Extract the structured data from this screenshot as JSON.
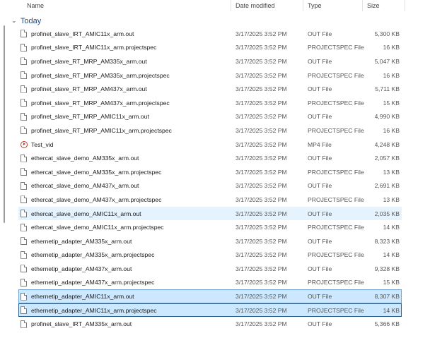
{
  "columns": {
    "name": "Name",
    "date": "Date modified",
    "type": "Type",
    "size": "Size"
  },
  "group": {
    "label": "Today",
    "chevron": "chevron-down-icon"
  },
  "files": [
    {
      "name": "profinet_slave_IRT_AMIC11x_arm.out",
      "date": "3/17/2025 3:52 PM",
      "type": "OUT File",
      "size": "5,300 KB",
      "icon": "file-icon",
      "state": ""
    },
    {
      "name": "profinet_slave_IRT_AMIC11x_arm.projectspec",
      "date": "3/17/2025 3:52 PM",
      "type": "PROJECTSPEC File",
      "size": "16 KB",
      "icon": "file-icon",
      "state": ""
    },
    {
      "name": "profinet_slave_RT_MRP_AM335x_arm.out",
      "date": "3/17/2025 3:52 PM",
      "type": "OUT File",
      "size": "5,047 KB",
      "icon": "file-icon",
      "state": ""
    },
    {
      "name": "profinet_slave_RT_MRP_AM335x_arm.projectspec",
      "date": "3/17/2025 3:52 PM",
      "type": "PROJECTSPEC File",
      "size": "16 KB",
      "icon": "file-icon",
      "state": ""
    },
    {
      "name": "profinet_slave_RT_MRP_AM437x_arm.out",
      "date": "3/17/2025 3:52 PM",
      "type": "OUT File",
      "size": "5,711 KB",
      "icon": "file-icon",
      "state": ""
    },
    {
      "name": "profinet_slave_RT_MRP_AM437x_arm.projectspec",
      "date": "3/17/2025 3:52 PM",
      "type": "PROJECTSPEC File",
      "size": "15 KB",
      "icon": "file-icon",
      "state": ""
    },
    {
      "name": "profinet_slave_RT_MRP_AMIC11x_arm.out",
      "date": "3/17/2025 3:52 PM",
      "type": "OUT File",
      "size": "4,990 KB",
      "icon": "file-icon",
      "state": ""
    },
    {
      "name": "profinet_slave_RT_MRP_AMIC11x_arm.projectspec",
      "date": "3/17/2025 3:52 PM",
      "type": "PROJECTSPEC File",
      "size": "16 KB",
      "icon": "file-icon",
      "state": ""
    },
    {
      "name": "Test_vid",
      "date": "3/17/2025 3:52 PM",
      "type": "MP4 File",
      "size": "4,248 KB",
      "icon": "video-icon",
      "state": ""
    },
    {
      "name": "ethercat_slave_demo_AM335x_arm.out",
      "date": "3/17/2025 3:52 PM",
      "type": "OUT File",
      "size": "2,057 KB",
      "icon": "file-icon",
      "state": ""
    },
    {
      "name": "ethercat_slave_demo_AM335x_arm.projectspec",
      "date": "3/17/2025 3:52 PM",
      "type": "PROJECTSPEC File",
      "size": "13 KB",
      "icon": "file-icon",
      "state": ""
    },
    {
      "name": "ethercat_slave_demo_AM437x_arm.out",
      "date": "3/17/2025 3:52 PM",
      "type": "OUT File",
      "size": "2,691 KB",
      "icon": "file-icon",
      "state": ""
    },
    {
      "name": "ethercat_slave_demo_AM437x_arm.projectspec",
      "date": "3/17/2025 3:52 PM",
      "type": "PROJECTSPEC File",
      "size": "13 KB",
      "icon": "file-icon",
      "state": ""
    },
    {
      "name": "ethercat_slave_demo_AMIC11x_arm.out",
      "date": "3/17/2025 3:52 PM",
      "type": "OUT File",
      "size": "2,035 KB",
      "icon": "file-icon",
      "state": "hover"
    },
    {
      "name": "ethercat_slave_demo_AMIC11x_arm.projectspec",
      "date": "3/17/2025 3:52 PM",
      "type": "PROJECTSPEC File",
      "size": "14 KB",
      "icon": "file-icon",
      "state": ""
    },
    {
      "name": "ethernetip_adapter_AM335x_arm.out",
      "date": "3/17/2025 3:52 PM",
      "type": "OUT File",
      "size": "8,323 KB",
      "icon": "file-icon",
      "state": ""
    },
    {
      "name": "ethernetip_adapter_AM335x_arm.projectspec",
      "date": "3/17/2025 3:52 PM",
      "type": "PROJECTSPEC File",
      "size": "14 KB",
      "icon": "file-icon",
      "state": ""
    },
    {
      "name": "ethernetip_adapter_AM437x_arm.out",
      "date": "3/17/2025 3:52 PM",
      "type": "OUT File",
      "size": "9,328 KB",
      "icon": "file-icon",
      "state": ""
    },
    {
      "name": "ethernetip_adapter_AM437x_arm.projectspec",
      "date": "3/17/2025 3:52 PM",
      "type": "PROJECTSPEC File",
      "size": "15 KB",
      "icon": "file-icon",
      "state": ""
    },
    {
      "name": "ethernetip_adapter_AMIC11x_arm.out",
      "date": "3/17/2025 3:52 PM",
      "type": "OUT File",
      "size": "8,307 KB",
      "icon": "file-icon",
      "state": "selected"
    },
    {
      "name": "ethernetip_adapter_AMIC11x_arm.projectspec",
      "date": "3/17/2025 3:52 PM",
      "type": "PROJECTSPEC File",
      "size": "14 KB",
      "icon": "file-icon",
      "state": "sel-focus"
    },
    {
      "name": "profinet_slave_IRT_AM335x_arm.out",
      "date": "3/17/2025 3:52 PM",
      "type": "OUT File",
      "size": "5,366 KB",
      "icon": "file-icon",
      "state": ""
    }
  ]
}
